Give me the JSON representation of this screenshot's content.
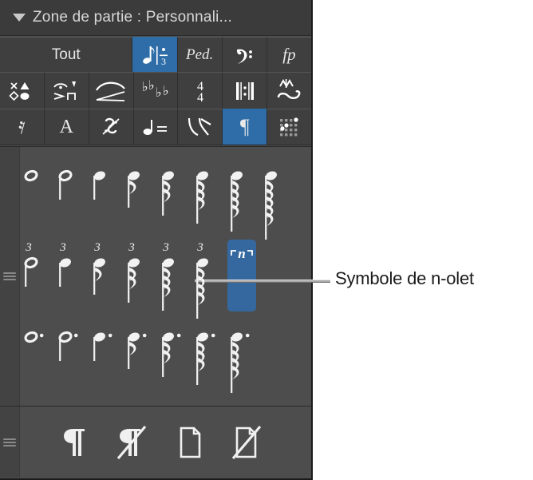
{
  "panel": {
    "title": "Zone de partie : Personnali...",
    "disclosure_icon": "triangle-down-icon",
    "accent_color": "#2e6da8",
    "selection_color": "#35689e",
    "panel_bg": "#4d4d4d",
    "toolbar_bg": "#3f3f3f",
    "titlebar_bg": "#3b3b3b"
  },
  "toolbar": {
    "row1": [
      {
        "label": "Tout",
        "icon": "all-text",
        "selected": false,
        "wide": true
      },
      {
        "label": "",
        "icon": "tuplet-eighth-over-three-icon",
        "selected": true,
        "wide": false
      },
      {
        "label": "Ped.",
        "icon": "pedal-icon",
        "selected": false,
        "wide": false
      },
      {
        "label": "",
        "icon": "bass-clef-icon",
        "selected": false,
        "wide": false
      },
      {
        "label": "fp",
        "icon": "dynamics-fp-icon",
        "selected": false,
        "wide": false
      }
    ],
    "row2": [
      {
        "icon": "noteheads-icon",
        "selected": false
      },
      {
        "icon": "articulations-icon",
        "selected": false
      },
      {
        "icon": "slur-hairpin-icon",
        "selected": false
      },
      {
        "icon": "accidentals-icon",
        "selected": false
      },
      {
        "icon": "time-signature-4-4-icon",
        "selected": false
      },
      {
        "icon": "repeat-barline-icon",
        "selected": false
      },
      {
        "icon": "ornaments-icon",
        "selected": false
      }
    ],
    "row3": [
      {
        "icon": "rest-icon",
        "selected": false
      },
      {
        "icon": "text-a-icon",
        "selected": false
      },
      {
        "icon": "segno-icon",
        "selected": false
      },
      {
        "icon": "tempo-note-equals-icon",
        "selected": false
      },
      {
        "icon": "bend-icon",
        "selected": false
      },
      {
        "icon": "pilcrow-icon",
        "selected": true
      },
      {
        "icon": "chord-grid-icon",
        "selected": false
      }
    ]
  },
  "grid": {
    "gutter_handle_icon": "drag-handle-icon",
    "row1": [
      {
        "name": "whole-note",
        "icon": "note-whole-icon",
        "flags": 0,
        "stem": false,
        "hollow": true,
        "dotted": false,
        "tuplet": false,
        "selected": false
      },
      {
        "name": "half-note",
        "icon": "note-half-icon",
        "flags": 0,
        "stem": true,
        "hollow": true,
        "dotted": false,
        "tuplet": false,
        "selected": false
      },
      {
        "name": "quarter-note",
        "icon": "note-quarter-icon",
        "flags": 0,
        "stem": true,
        "hollow": false,
        "dotted": false,
        "tuplet": false,
        "selected": false
      },
      {
        "name": "eighth-note",
        "icon": "note-eighth-icon",
        "flags": 1,
        "stem": true,
        "hollow": false,
        "dotted": false,
        "tuplet": false,
        "selected": false
      },
      {
        "name": "sixteenth-note",
        "icon": "note-16th-icon",
        "flags": 2,
        "stem": true,
        "hollow": false,
        "dotted": false,
        "tuplet": false,
        "selected": false
      },
      {
        "name": "thirtysecond-note",
        "icon": "note-32nd-icon",
        "flags": 3,
        "stem": true,
        "hollow": false,
        "dotted": false,
        "tuplet": false,
        "selected": false
      },
      {
        "name": "sixtyfourth-note",
        "icon": "note-64th-icon",
        "flags": 4,
        "stem": true,
        "hollow": false,
        "dotted": false,
        "tuplet": false,
        "selected": false
      },
      {
        "name": "onetwentyeighth-note",
        "icon": "note-128th-icon",
        "flags": 5,
        "stem": true,
        "hollow": false,
        "dotted": false,
        "tuplet": false,
        "selected": false
      }
    ],
    "row2": [
      {
        "name": "triplet-half-note",
        "icon": "triplet-half-icon",
        "flags": 0,
        "stem": true,
        "hollow": true,
        "dotted": false,
        "tuplet": true,
        "tuplet_number": "3",
        "selected": false
      },
      {
        "name": "triplet-quarter-note",
        "icon": "triplet-quarter-icon",
        "flags": 0,
        "stem": true,
        "hollow": false,
        "dotted": false,
        "tuplet": true,
        "tuplet_number": "3",
        "selected": false
      },
      {
        "name": "triplet-eighth-note",
        "icon": "triplet-eighth-icon",
        "flags": 1,
        "stem": true,
        "hollow": false,
        "dotted": false,
        "tuplet": true,
        "tuplet_number": "3",
        "selected": false
      },
      {
        "name": "triplet-sixteenth-note",
        "icon": "triplet-16th-icon",
        "flags": 2,
        "stem": true,
        "hollow": false,
        "dotted": false,
        "tuplet": true,
        "tuplet_number": "3",
        "selected": false
      },
      {
        "name": "triplet-thirtysecond-note",
        "icon": "triplet-32nd-icon",
        "flags": 3,
        "stem": true,
        "hollow": false,
        "dotted": false,
        "tuplet": true,
        "tuplet_number": "3",
        "selected": false
      },
      {
        "name": "triplet-sixtyfourth-note",
        "icon": "triplet-64th-icon",
        "flags": 4,
        "stem": true,
        "hollow": false,
        "dotted": false,
        "tuplet": true,
        "tuplet_number": "3",
        "selected": false
      },
      {
        "name": "n-tuplet-symbol",
        "icon": "n-tuplet-icon",
        "symbol": "n",
        "selected": true
      }
    ],
    "row3": [
      {
        "name": "dotted-whole-note",
        "icon": "note-whole-dotted-icon",
        "flags": 0,
        "stem": false,
        "hollow": true,
        "dotted": true,
        "tuplet": false,
        "selected": false
      },
      {
        "name": "dotted-half-note",
        "icon": "note-half-dotted-icon",
        "flags": 0,
        "stem": true,
        "hollow": true,
        "dotted": true,
        "tuplet": false,
        "selected": false
      },
      {
        "name": "dotted-quarter-note",
        "icon": "note-quarter-dotted-icon",
        "flags": 0,
        "stem": true,
        "hollow": false,
        "dotted": true,
        "tuplet": false,
        "selected": false
      },
      {
        "name": "dotted-eighth-note",
        "icon": "note-eighth-dotted-icon",
        "flags": 1,
        "stem": true,
        "hollow": false,
        "dotted": true,
        "tuplet": false,
        "selected": false
      },
      {
        "name": "dotted-sixteenth-note",
        "icon": "note-16th-dotted-icon",
        "flags": 2,
        "stem": true,
        "hollow": false,
        "dotted": true,
        "tuplet": false,
        "selected": false
      },
      {
        "name": "dotted-thirtysecond-note",
        "icon": "note-32nd-dotted-icon",
        "flags": 3,
        "stem": true,
        "hollow": false,
        "dotted": true,
        "tuplet": false,
        "selected": false
      },
      {
        "name": "dotted-sixtyfourth-note",
        "icon": "note-64th-dotted-icon",
        "flags": 4,
        "stem": true,
        "hollow": false,
        "dotted": true,
        "tuplet": false,
        "selected": false
      }
    ]
  },
  "bottom_bar": {
    "handle_icon": "drag-handle-icon",
    "items": [
      {
        "name": "pilcrow",
        "icon": "pilcrow-icon",
        "struck": false
      },
      {
        "name": "hide-pilcrow",
        "icon": "pilcrow-struck-icon",
        "struck": true
      },
      {
        "name": "page",
        "icon": "page-icon",
        "struck": false
      },
      {
        "name": "hide-page",
        "icon": "page-struck-icon",
        "struck": true
      }
    ]
  },
  "callout": {
    "label": "Symbole de n-olet",
    "leader_color": "#a9a9a9"
  }
}
